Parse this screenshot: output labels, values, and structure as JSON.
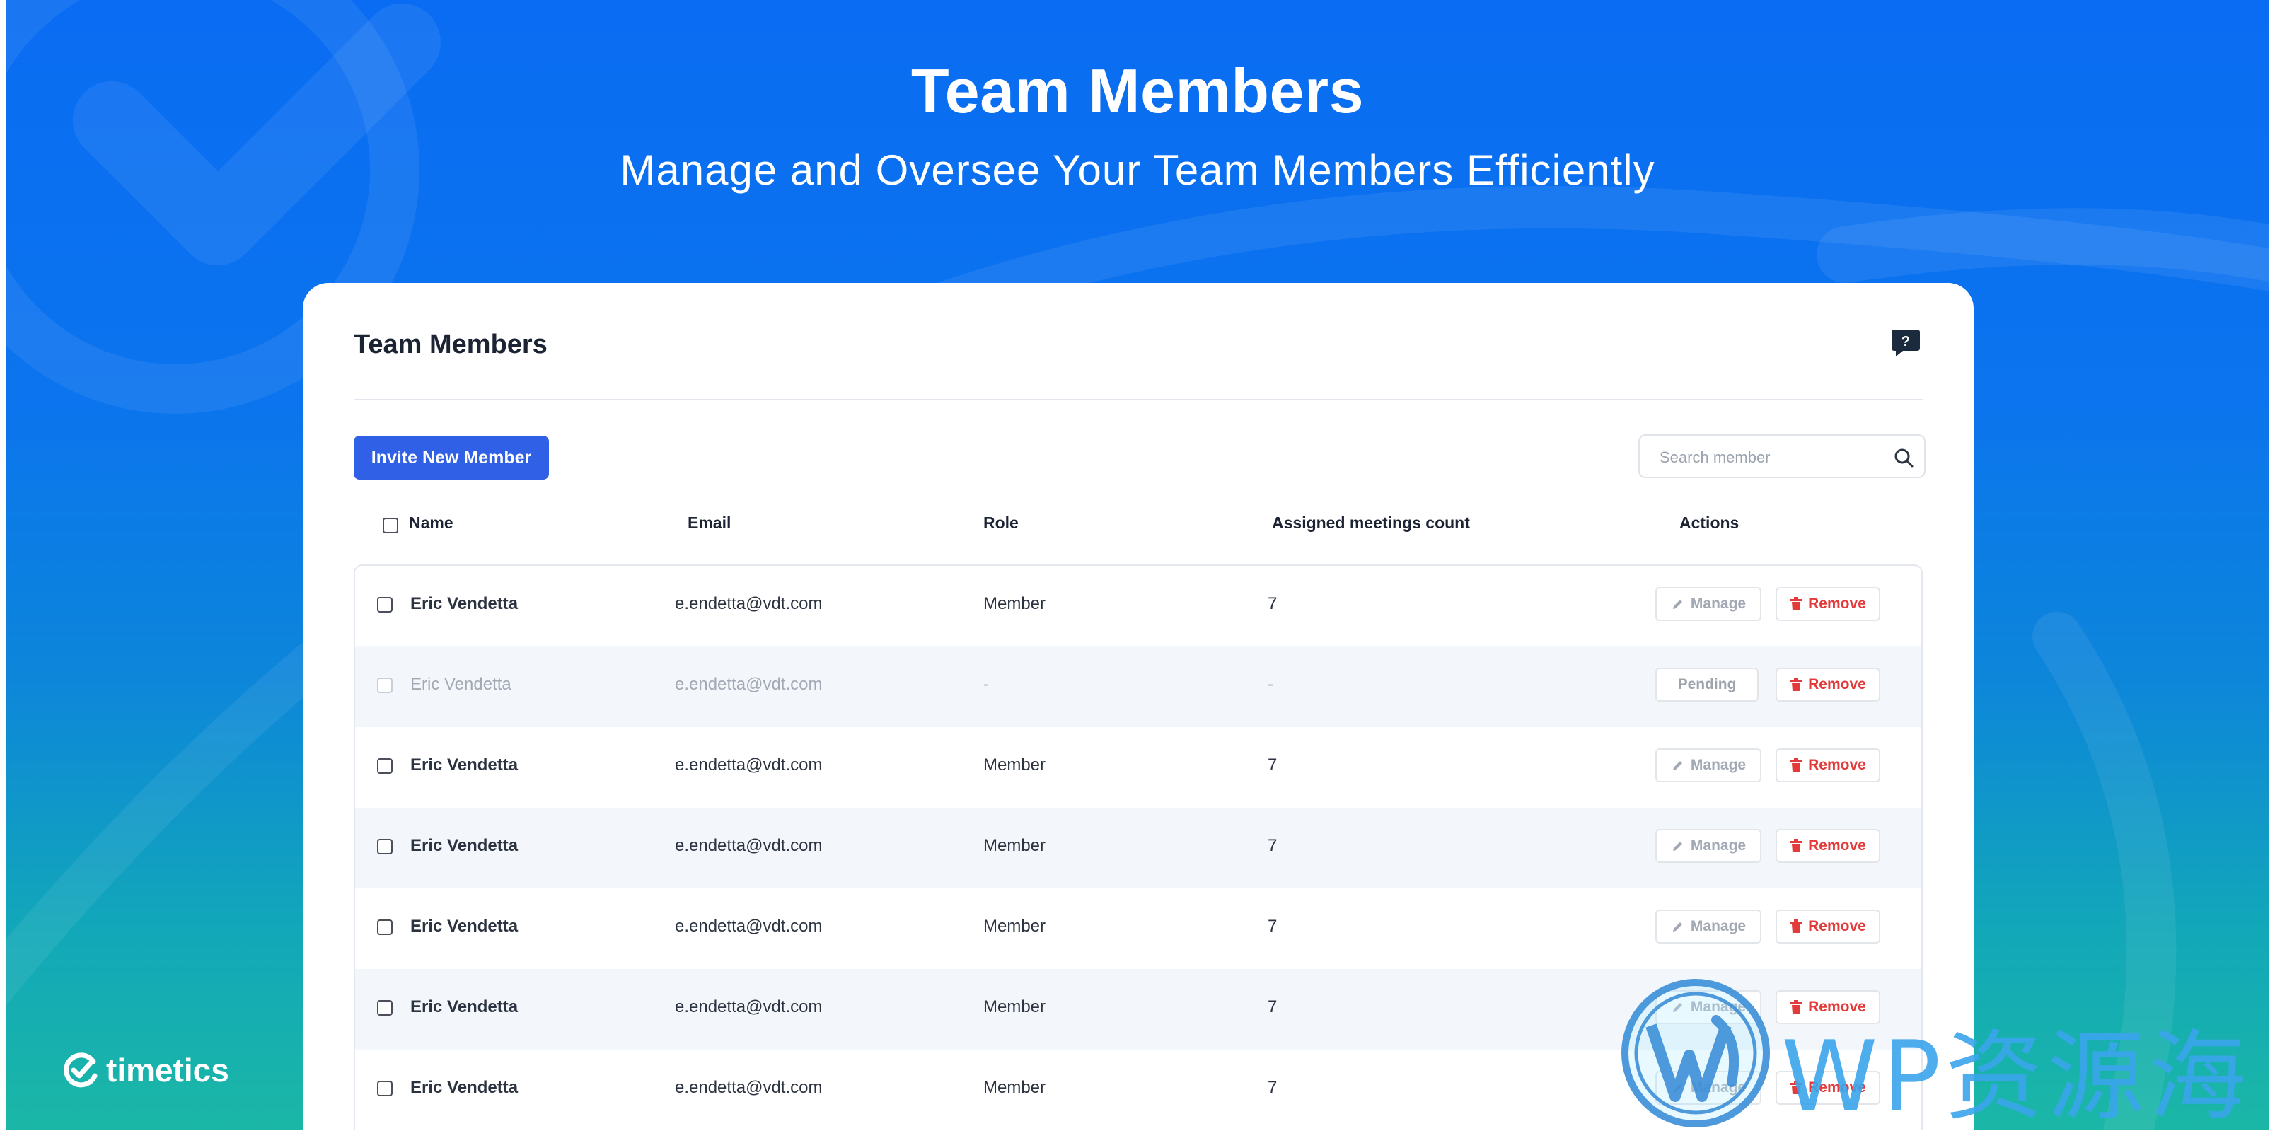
{
  "hero": {
    "title": "Team Members",
    "subtitle": "Manage and Oversee Your Team Members Efficiently"
  },
  "brand": {
    "name": "timetics"
  },
  "card": {
    "title": "Team Members",
    "invite_label": "Invite New Member",
    "search_placeholder": "Search member"
  },
  "table": {
    "columns": [
      "Name",
      "Email",
      "Role",
      "Assigned meetings count",
      "Actions"
    ],
    "manage_label": "Manage",
    "remove_label": "Remove",
    "pending_label": "Pending",
    "rows": [
      {
        "name": "Eric Vendetta",
        "email": "e.endetta@vdt.com",
        "role": "Member",
        "count": "7"
      },
      {
        "name": "Eric Vendetta",
        "email": "e.endetta@vdt.com",
        "role": "-",
        "count": "-"
      },
      {
        "name": "Eric Vendetta",
        "email": "e.endetta@vdt.com",
        "role": "Member",
        "count": "7"
      },
      {
        "name": "Eric Vendetta",
        "email": "e.endetta@vdt.com",
        "role": "Member",
        "count": "7"
      },
      {
        "name": "Eric Vendetta",
        "email": "e.endetta@vdt.com",
        "role": "Member",
        "count": "7"
      },
      {
        "name": "Eric Vendetta",
        "email": "e.endetta@vdt.com",
        "role": "Member",
        "count": "7"
      },
      {
        "name": "Eric Vendetta",
        "email": "e.endetta@vdt.com",
        "role": "Member",
        "count": "7"
      }
    ]
  },
  "watermark": {
    "text": "WP资源海"
  },
  "colors": {
    "primary": "#2f60e6",
    "danger": "#e23b3b",
    "text": "#1c2434",
    "hero_bg": "#0a6cf2"
  }
}
